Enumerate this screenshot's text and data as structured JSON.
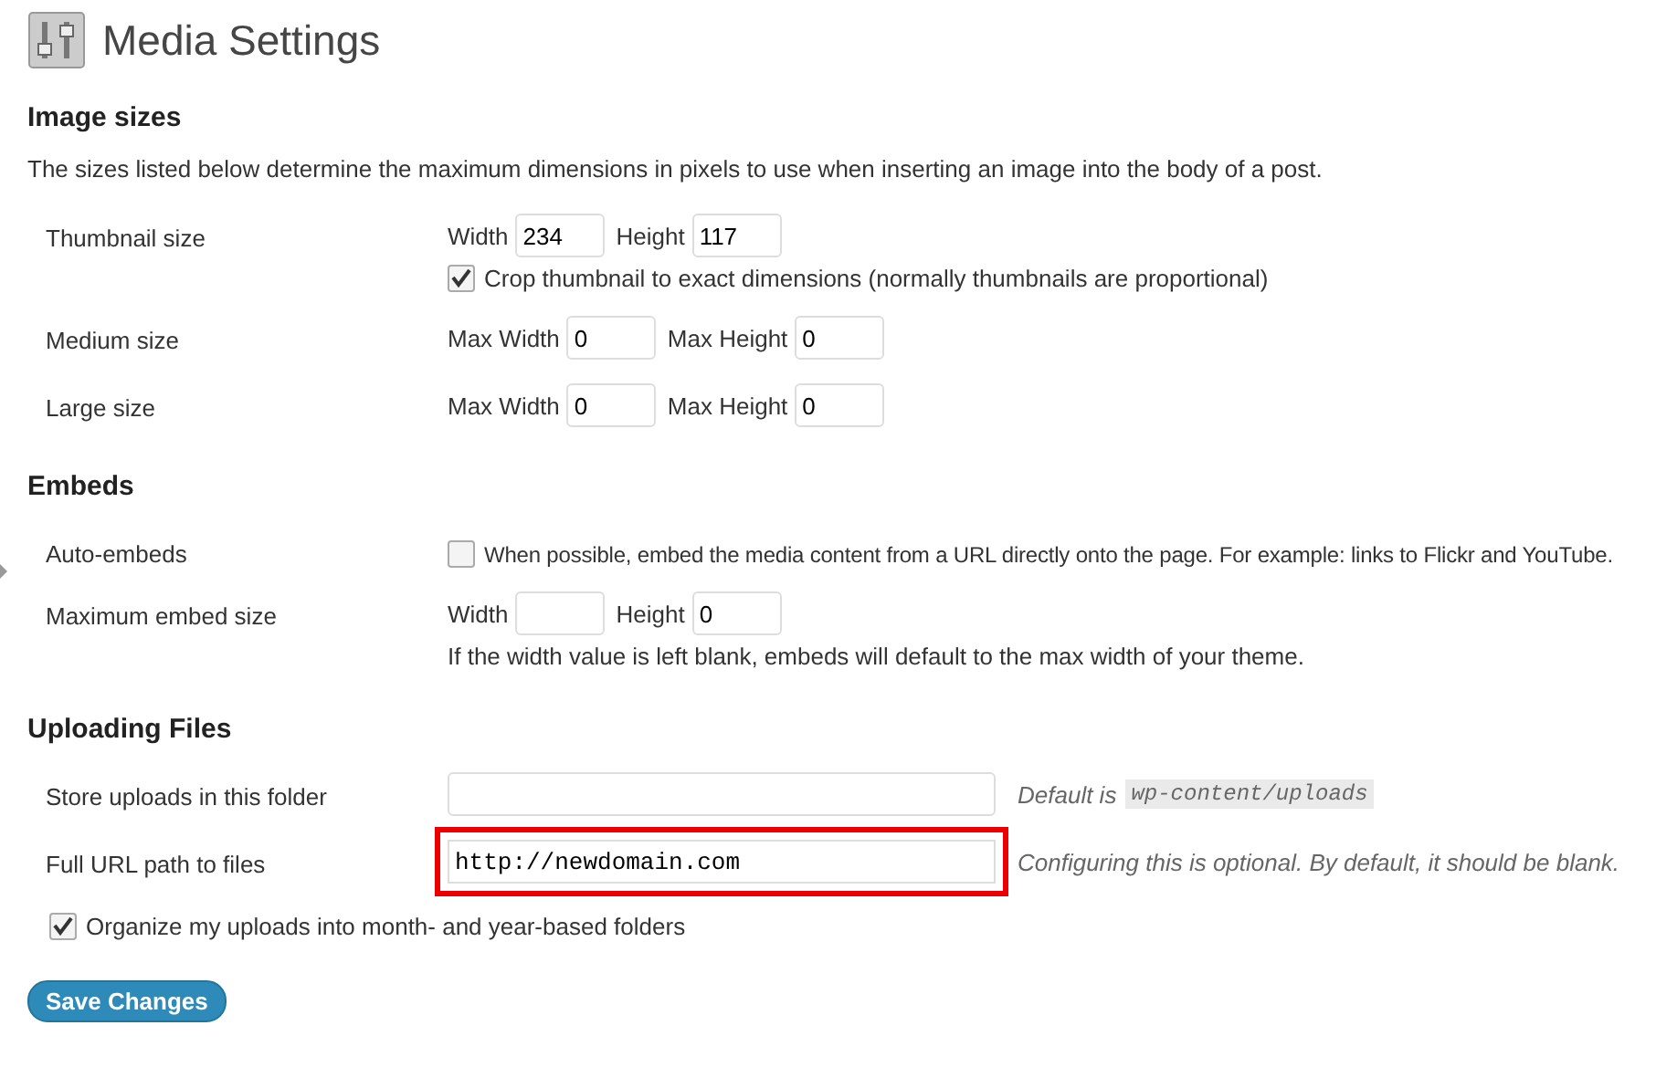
{
  "title": "Media Settings",
  "sections": [
    {
      "heading": "Image sizes",
      "description": "The sizes listed below determine the maximum dimensions in pixels to use when inserting an image into the body of a post.",
      "rows": [
        {
          "kind": "size",
          "label": "Thumbnail size",
          "fields": [
            {
              "label": "Width",
              "value": "234"
            },
            {
              "label": "Height",
              "value": "117"
            }
          ],
          "checkbox": {
            "label": "Crop thumbnail to exact dimensions (normally thumbnails are proportional)",
            "checked": true
          }
        },
        {
          "kind": "size",
          "label": "Medium size",
          "fields": [
            {
              "label": "Max Width",
              "value": "0"
            },
            {
              "label": "Max Height",
              "value": "0"
            }
          ]
        },
        {
          "kind": "size",
          "label": "Large size",
          "fields": [
            {
              "label": "Max Width",
              "value": "0"
            },
            {
              "label": "Max Height",
              "value": "0"
            }
          ]
        }
      ]
    },
    {
      "heading": "Embeds",
      "rows": [
        {
          "kind": "checkbox",
          "label": "Auto-embeds",
          "checkbox": {
            "label": "When possible, embed the media content from a URL directly onto the page. For example: links to Flickr and YouTube.",
            "checked": false
          }
        },
        {
          "kind": "size",
          "label": "Maximum embed size",
          "fields": [
            {
              "label": "Width"
            },
            {
              "label": "Height",
              "value": "0"
            }
          ],
          "note": "If the width value is left blank, embeds will default to the max width of your theme."
        }
      ]
    },
    {
      "heading": "Uploading Files",
      "rows": [
        {
          "kind": "path",
          "label": "Store uploads in this folder",
          "note": "Default is",
          "code": "wp-content/uploads",
          "highlight": false
        },
        {
          "kind": "path",
          "label": "Full URL path to files",
          "value": "http://newdomain.com",
          "note": "Configuring this is optional. By default, it should be blank.",
          "highlight": true
        }
      ]
    }
  ],
  "organize": {
    "label": "Organize my uploads into month- and year-based folders",
    "checked": true
  },
  "button": "Save Changes"
}
